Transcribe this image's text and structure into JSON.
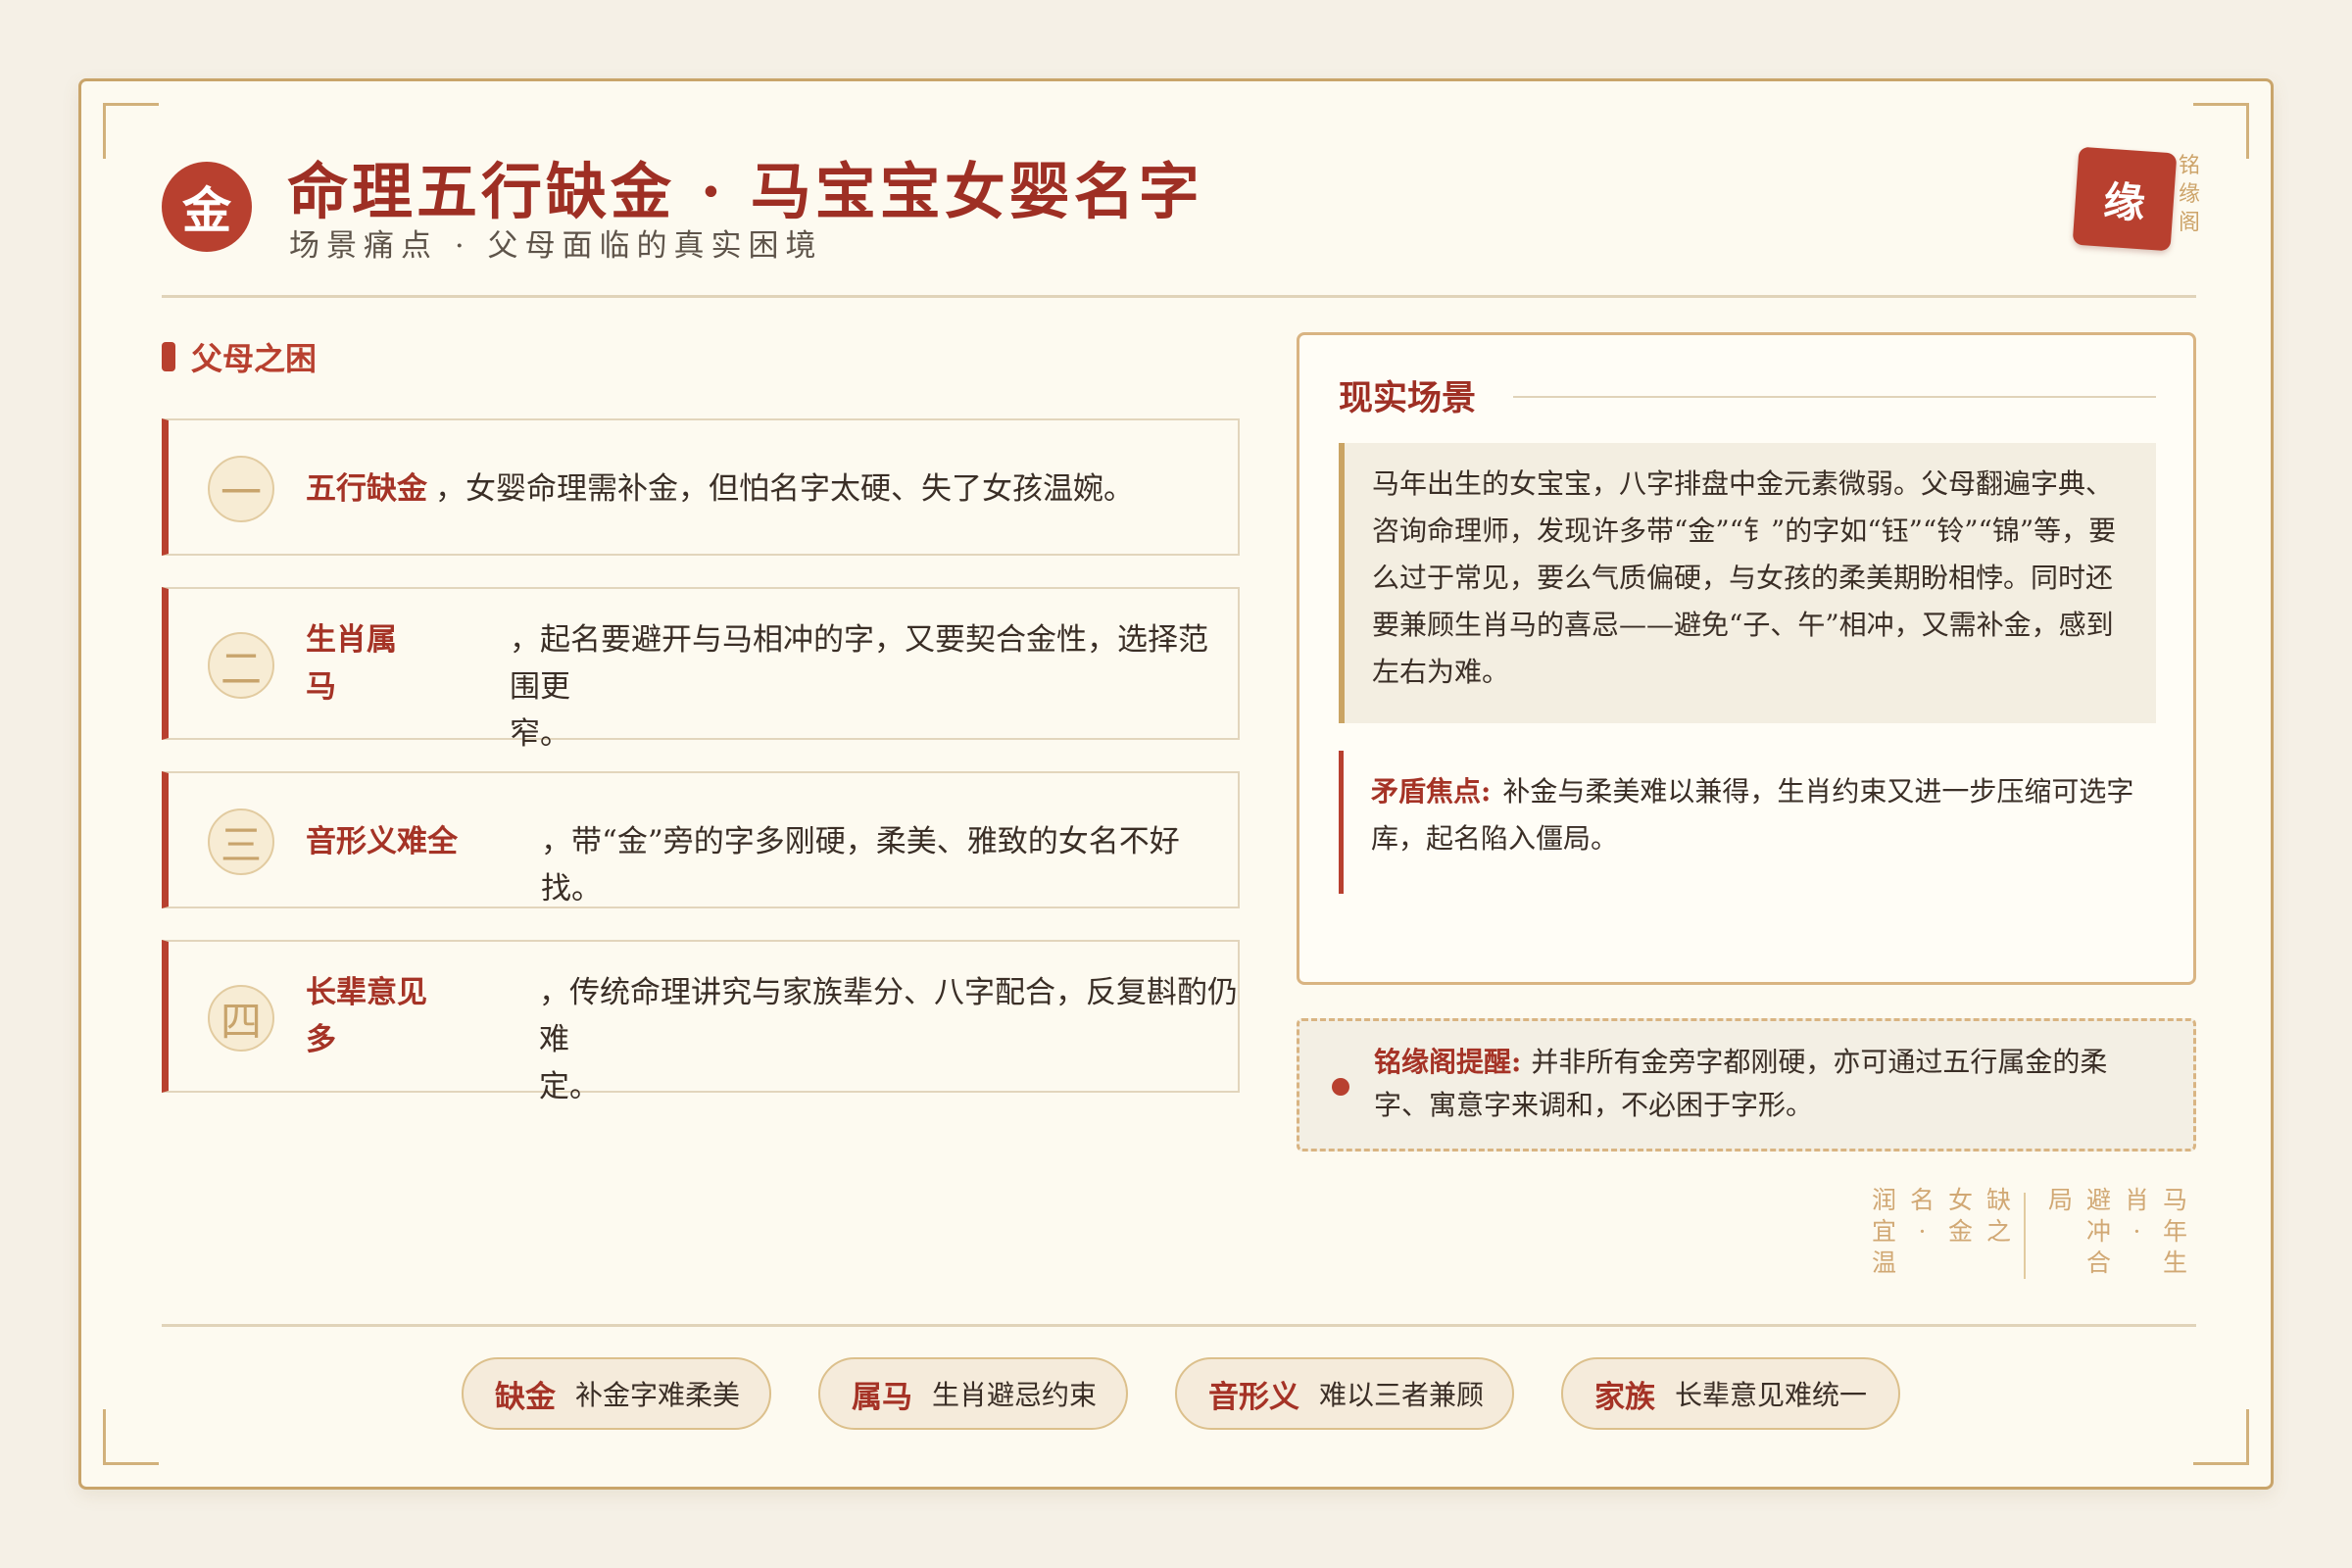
{
  "header": {
    "badge": "金",
    "title": "命理五行缺金 · 马宝宝女婴名字",
    "subtitle": "场景痛点 · 父母面临的真实困境",
    "seal": "缘",
    "seal_side": [
      "铭",
      "缘",
      "阁"
    ]
  },
  "left": {
    "section_title": "父母之困",
    "items": [
      {
        "num": "一",
        "keyword": "五行缺金",
        "text": "，女婴命理需补金，但怕名字太硬、失了女孩温婉。"
      },
      {
        "num": "二",
        "keyword_lines": [
          "生肖属",
          "马"
        ],
        "text_lines": [
          "，起名要避开与马相冲的字，又要契合金性，选择范围更",
          "窄。"
        ]
      },
      {
        "num": "三",
        "keyword": "音形义难全",
        "text": "，带“金”旁的字多刚硬，柔美、雅致的女名不好找。"
      },
      {
        "num": "四",
        "keyword_lines": [
          "长辈意见",
          "多"
        ],
        "text_lines": [
          "，传统命理讲究与家族辈分、八字配合，反复斟酌仍难",
          "定。"
        ]
      }
    ]
  },
  "reality": {
    "title": "现实场景",
    "quote": "马年出生的女宝宝，八字排盘中金元素微弱。父母翻遍字典、咨询命理师，发现许多带“金”“钅”的字如“钰”“铃”“锦”等，要么过于常见，要么气质偏硬，与女孩的柔美期盼相悖。同时还要兼顾生肖马的喜忌——避免“子、午”相冲，又需补金，感到左右为难。",
    "focus_label": "矛盾焦点:",
    "focus_text": "补金与柔美难以兼得，生肖约束又进一步压缩可选字库，起名陷入僵局。"
  },
  "tip": {
    "label": "铭缘阁提醒:",
    "text": "并非所有金旁字都刚硬，亦可通过五行属金的柔字、寓意字来调和，不必困于字形。"
  },
  "vertical_text": {
    "left_group": [
      "润宜温",
      "名·",
      "女金",
      "缺之"
    ],
    "right_group": [
      "局",
      "避冲合",
      "肖·",
      "马年生"
    ]
  },
  "footer": {
    "pills": [
      {
        "key": "缺金",
        "value": "补金字难柔美"
      },
      {
        "key": "属马",
        "value": "生肖避忌约束"
      },
      {
        "key": "音形义",
        "value": "难以三者兼顾"
      },
      {
        "key": "家族",
        "value": "长辈意见难统一"
      }
    ]
  }
}
